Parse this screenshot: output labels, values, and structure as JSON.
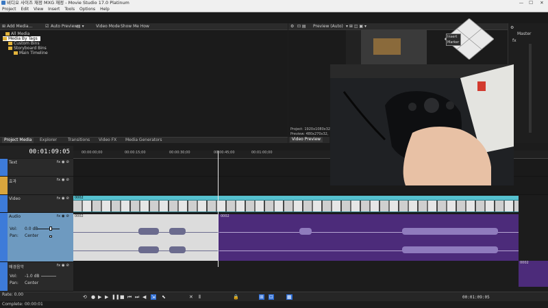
{
  "titlebar": {
    "title": "비디오 사이즈 재정 MXG 재정 - Movie Studio 17.0 Platinum",
    "minimize": "—",
    "maximize": "☐",
    "close": "✕"
  },
  "menu": [
    "Project",
    "Edit",
    "View",
    "Insert",
    "Tools",
    "Options",
    "Help"
  ],
  "media_toolbar": {
    "add_media": "Add Media...",
    "auto_preview": "Auto Preview",
    "video_mode": "Video Mode",
    "show_me_how": "Show Me How"
  },
  "media_tree": [
    "All Media",
    "Media By Tags",
    "Custom Bins",
    "Storyboard Bins",
    "Main Timeline"
  ],
  "preview_toolbar": {
    "label": "Preview (Auto)"
  },
  "right_panel": {
    "title": "Master",
    "fx": "fx"
  },
  "tabs": [
    "Project Media",
    "Explorer",
    "Transitions",
    "Video FX",
    "Media Generators"
  ],
  "preview_tab": "Video Preview",
  "preview_info": {
    "project": "Project: 1920x1080x32,",
    "preview": "Preview: 480x270x32,"
  },
  "overlay": {
    "insert": "Insert",
    "marker": "Marker"
  },
  "timeline": {
    "timecode": "00:01:09:05",
    "ruler_ticks": [
      "00:00:00;00",
      "00:00:15;00",
      "00:00:30;00",
      "00:00:45;00",
      "00:01:00;00"
    ],
    "tracks": [
      {
        "name": "Text",
        "color": "#3d7bd9"
      },
      {
        "name": "효과",
        "color": "#d9a53d"
      },
      {
        "name": "Video",
        "color": "#3d7bd9"
      },
      {
        "name": "Audio",
        "color": "#3d7bd9",
        "vol": "Vol:",
        "vol_value": "0.0 dB",
        "pan": "Pan:",
        "pan_value": "Center"
      },
      {
        "name": "배경음악",
        "color": "#3d7bd9",
        "vol": "Vol:",
        "vol_value": "-1.0 dB",
        "pan": "Pan:",
        "pan_value": "Center"
      }
    ],
    "video_clip": "0002",
    "audio_clip_a": "0002",
    "audio_clip_b": "0002",
    "music_clip": "0002",
    "track_icons": "fx ◉ ⊘"
  },
  "transport": {
    "time_readout": "00:01:09:05"
  },
  "status": {
    "rate": "Rate: 0.00",
    "complete": "Complete: 00:00:01"
  }
}
